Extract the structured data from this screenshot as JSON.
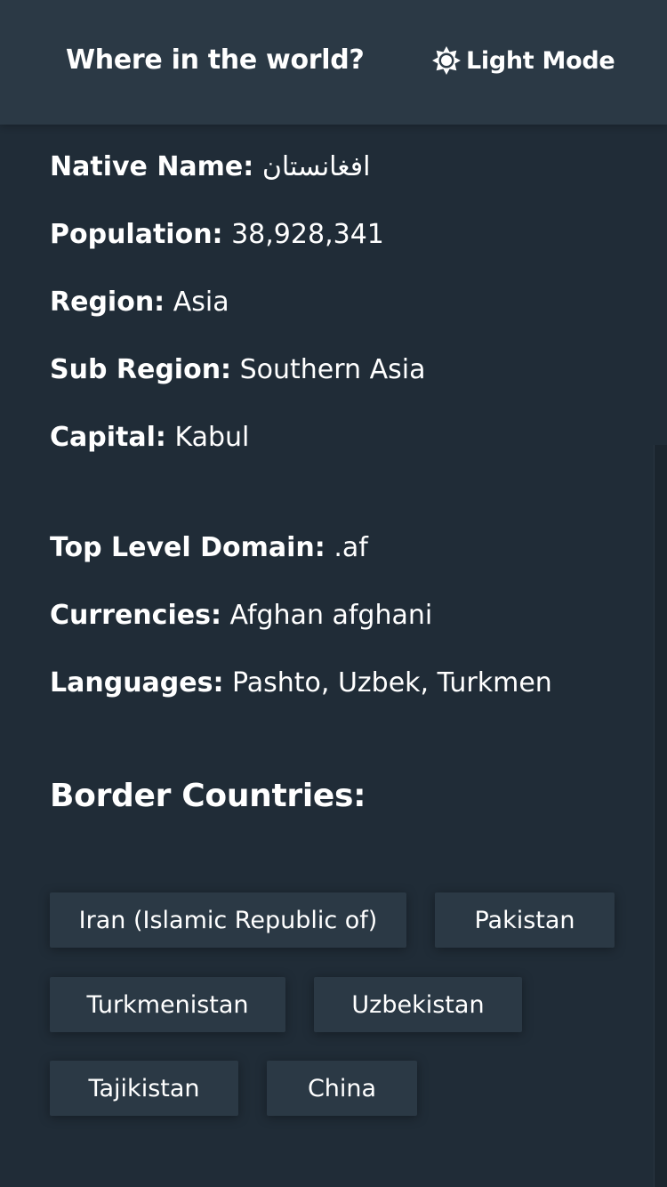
{
  "header": {
    "title": "Where in the world?",
    "mode_label": "Light Mode",
    "mode_icon": "sun-icon"
  },
  "details": [
    {
      "label": "Native Name:",
      "value": "افغانستان"
    },
    {
      "label": "Population:",
      "value": "38,928,341"
    },
    {
      "label": "Region:",
      "value": "Asia"
    },
    {
      "label": "Sub Region:",
      "value": "Southern Asia"
    },
    {
      "label": "Capital:",
      "value": "Kabul"
    },
    {
      "label": "Top Level Domain:",
      "value": ".af"
    },
    {
      "label": "Currencies:",
      "value": "Afghan afghani"
    },
    {
      "label": "Languages:",
      "value": "Pashto, Uzbek, Turkmen"
    }
  ],
  "border": {
    "title": "Border Countries:",
    "countries": [
      "Iran (Islamic Republic of)",
      "Pakistan",
      "Turkmenistan",
      "Uzbekistan",
      "Tajikistan",
      "China"
    ]
  },
  "colors": {
    "background": "#202c37",
    "element": "#2b3945",
    "text": "#ffffff"
  }
}
